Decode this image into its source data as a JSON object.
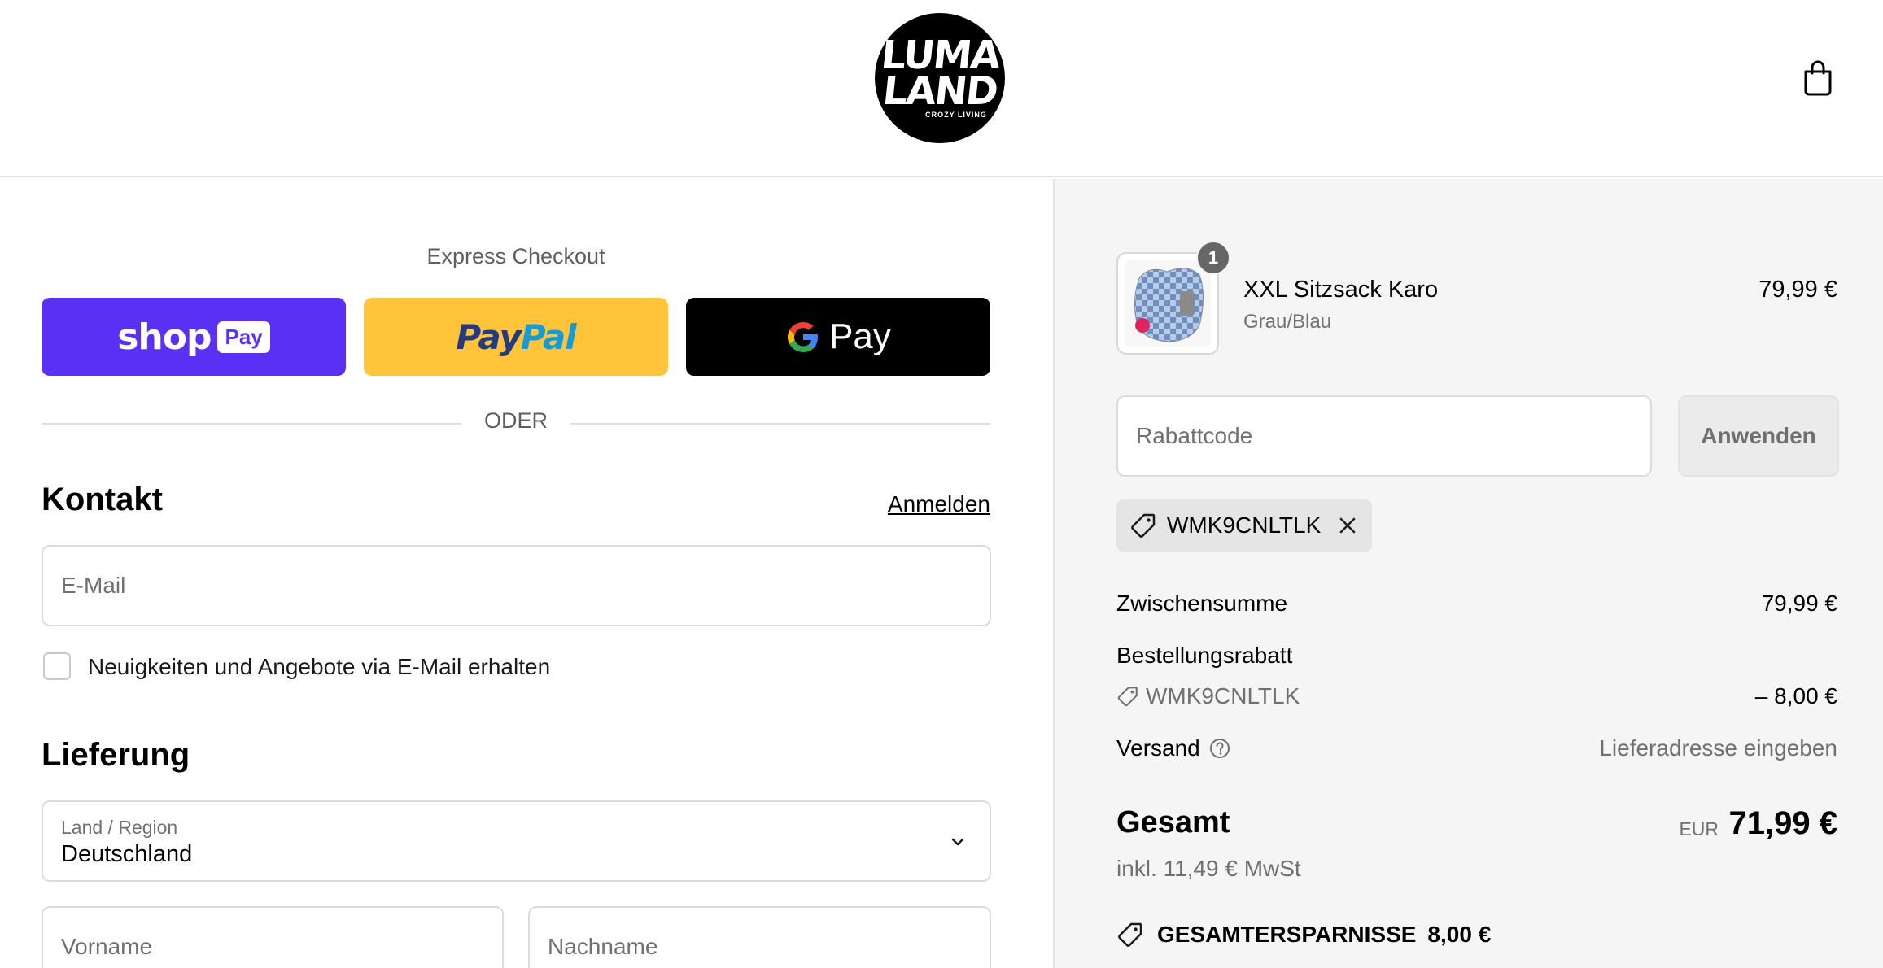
{
  "header": {
    "logo_line1": "LUMA",
    "logo_line2": "LAND",
    "logo_tagline": "CROZY LIVING"
  },
  "express": {
    "title": "Express Checkout",
    "shop_word": "shop",
    "shop_pay": "Pay",
    "paypal_a": "Pay",
    "paypal_b": "Pal",
    "gpay_word": "Pay",
    "divider": "ODER"
  },
  "contact": {
    "heading": "Kontakt",
    "login_link": "Anmelden",
    "email_placeholder": "E-Mail",
    "newsletter_label": "Neuigkeiten und Angebote via E-Mail erhalten"
  },
  "delivery": {
    "heading": "Lieferung",
    "country_label": "Land / Region",
    "country_value": "Deutschland",
    "firstname_placeholder": "Vorname",
    "lastname_placeholder": "Nachname"
  },
  "summary": {
    "product": {
      "quantity": "1",
      "name": "XXL Sitzsack Karo",
      "variant": "Grau/Blau",
      "price": "79,99 €"
    },
    "discount_placeholder": "Rabattcode",
    "apply_label": "Anwenden",
    "applied_code": "WMK9CNLTLK",
    "subtotal_label": "Zwischensumme",
    "subtotal_value": "79,99 €",
    "order_discount_label": "Bestellungsrabatt",
    "order_discount_code": "WMK9CNLTLK",
    "order_discount_value": "– 8,00 €",
    "shipping_label": "Versand",
    "shipping_value": "Lieferadresse eingeben",
    "total_label": "Gesamt",
    "total_currency": "EUR",
    "total_value": "71,99 €",
    "tax_note": "inkl. 11,49 € MwSt",
    "savings_label": "GESAMTERSPARNISSE",
    "savings_value": "8,00 €"
  },
  "colors": {
    "shop_pay": "#5a31f4",
    "paypal": "#ffc439",
    "gpay": "#000000",
    "summary_bg": "#f5f5f5"
  }
}
